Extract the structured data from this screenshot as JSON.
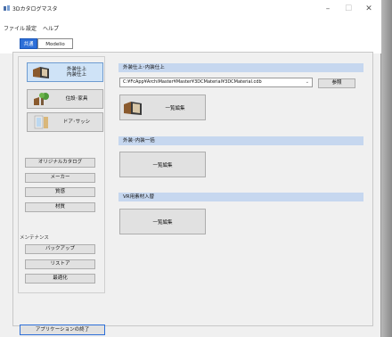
{
  "window": {
    "title": "3Dカタログマスタ",
    "minimize": "–",
    "maximize": "☐",
    "close": "✕"
  },
  "menu": [
    "ファイル",
    "設定",
    "ヘルプ"
  ],
  "tabs": [
    {
      "label": "共通"
    },
    {
      "label": "Modelio"
    }
  ],
  "categories": [
    {
      "label_line1": "外装仕上",
      "label_line2": "内装仕上"
    },
    {
      "label": "住設･家具"
    },
    {
      "label": "ドア･サッシ"
    }
  ],
  "catalog_buttons": [
    "オリジナルカタログ",
    "メーカー",
    "質感",
    "材質"
  ],
  "maintenance": {
    "label": "メンテナンス",
    "buttons": [
      "バックアップ",
      "リストア",
      "最適化"
    ]
  },
  "exit_button": "アプリケーションの終了",
  "sections": [
    {
      "header": "外装仕上･内装仕上",
      "path": "C:¥FcApp¥ArchiMaster¥Master¥3DCMaterial¥3DCMaterial.cdb",
      "browse": "参照",
      "edit": "一覧編集"
    },
    {
      "header": "外装･内装一括",
      "edit": "一覧編集"
    },
    {
      "header": "VR用素材入替",
      "edit": "一覧編集"
    }
  ],
  "colors": {
    "accent": "#2d6fd8",
    "section_header": "#c6d7ef",
    "selected_category": "#cfe3f7"
  }
}
